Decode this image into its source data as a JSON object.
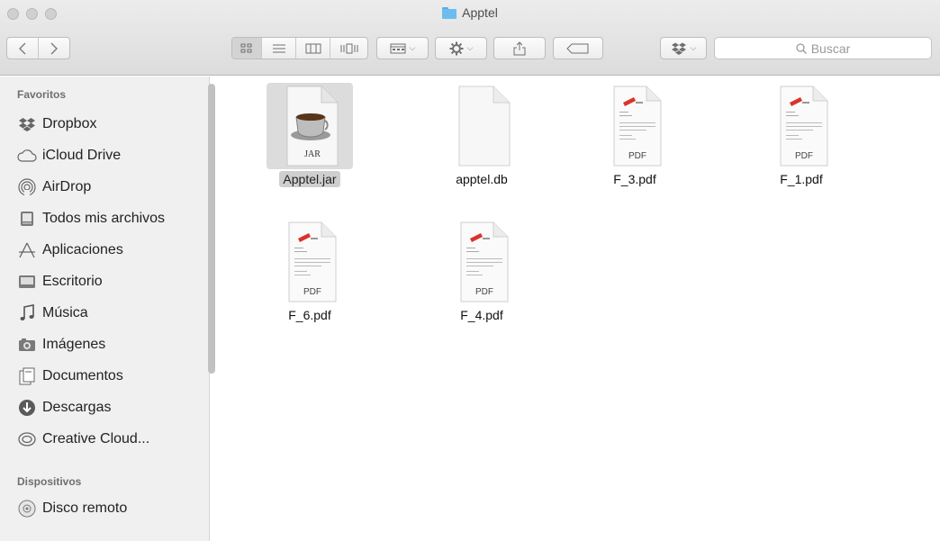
{
  "window": {
    "title": "Apptel"
  },
  "toolbar": {
    "search_placeholder": "Buscar"
  },
  "sidebar": {
    "favorites_header": "Favoritos",
    "favorites": [
      {
        "label": "Dropbox",
        "icon": "dropbox-icon"
      },
      {
        "label": "iCloud Drive",
        "icon": "cloud-icon"
      },
      {
        "label": "AirDrop",
        "icon": "airdrop-icon"
      },
      {
        "label": "Todos mis archivos",
        "icon": "all-files-icon"
      },
      {
        "label": "Aplicaciones",
        "icon": "applications-icon"
      },
      {
        "label": "Escritorio",
        "icon": "desktop-icon"
      },
      {
        "label": "Música",
        "icon": "music-icon"
      },
      {
        "label": "Imágenes",
        "icon": "camera-icon"
      },
      {
        "label": "Documentos",
        "icon": "documents-icon"
      },
      {
        "label": "Descargas",
        "icon": "downloads-icon"
      },
      {
        "label": "Creative Cloud...",
        "icon": "creative-cloud-icon"
      }
    ],
    "devices_header": "Dispositivos",
    "devices": [
      {
        "label": "Disco remoto",
        "icon": "disc-icon"
      }
    ]
  },
  "files": [
    {
      "name": "Apptel.jar",
      "type": "jar",
      "badge": "JAR",
      "selected": true
    },
    {
      "name": "apptel.db",
      "type": "blank",
      "badge": "",
      "selected": false
    },
    {
      "name": "F_3.pdf",
      "type": "pdf",
      "badge": "PDF",
      "selected": false
    },
    {
      "name": "F_1.pdf",
      "type": "pdf",
      "badge": "PDF",
      "selected": false
    },
    {
      "name": "F_6.pdf",
      "type": "pdf",
      "badge": "PDF",
      "selected": false
    },
    {
      "name": "F_4.pdf",
      "type": "pdf",
      "badge": "PDF",
      "selected": false
    }
  ]
}
